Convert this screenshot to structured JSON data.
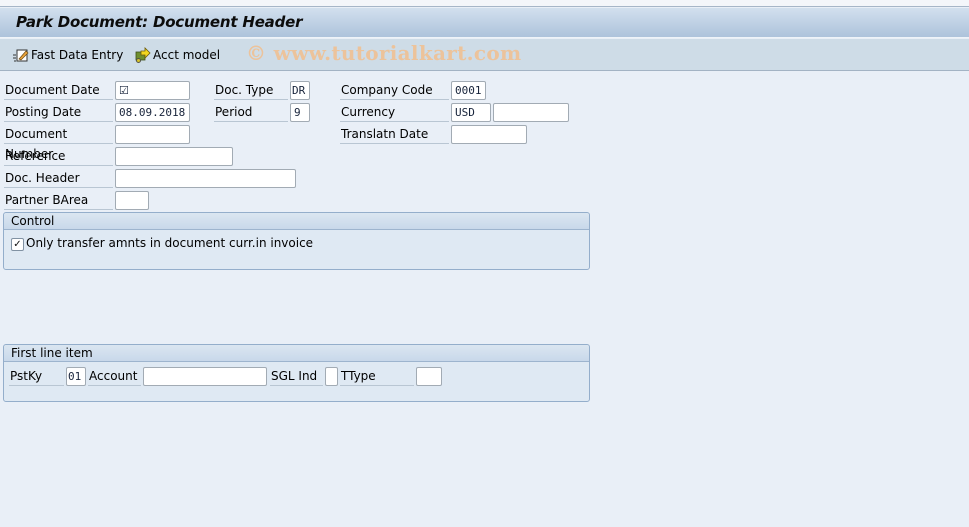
{
  "title": "Park Document: Document Header",
  "toolbar": {
    "fast_data_entry": {
      "label": "Fast Data Entry",
      "icon": "fast-data-entry-icon"
    },
    "acct_model": {
      "label": "Acct model",
      "icon": "account-model-icon"
    },
    "watermark": "© www.tutorialkart.com"
  },
  "header_fields": {
    "document_date": {
      "label": "Document Date",
      "value": "☑"
    },
    "doc_type": {
      "label": "Doc. Type",
      "value": "DR"
    },
    "company_code": {
      "label": "Company Code",
      "value": "0001"
    },
    "posting_date": {
      "label": "Posting Date",
      "value": "08.09.2018"
    },
    "period": {
      "label": "Period",
      "value": "9"
    },
    "currency": {
      "label": "Currency",
      "value": "USD",
      "value2": ""
    },
    "document_number": {
      "label": "Document Number",
      "value": ""
    },
    "translatn_date": {
      "label": "Translatn Date",
      "value": ""
    },
    "reference": {
      "label": "Reference",
      "value": ""
    },
    "doc_header": {
      "label": "Doc. Header",
      "value": ""
    },
    "partner_barea": {
      "label": "Partner BArea",
      "value": ""
    }
  },
  "control": {
    "title": "Control",
    "checkbox_label": "Only transfer amnts in document curr.in invoice",
    "checkbox_checked": true,
    "check_mark": "✓"
  },
  "first_line_item": {
    "title": "First line item",
    "pstky": {
      "label": "PstKy",
      "value": "01"
    },
    "account": {
      "label": "Account",
      "value": ""
    },
    "sgl_ind": {
      "label": "SGL Ind",
      "value": ""
    },
    "ttype": {
      "label": "TType",
      "value": ""
    }
  },
  "colors": {
    "background": "#e9eff7",
    "toolbar": "#cedce7",
    "watermark": "#ecc39b"
  }
}
